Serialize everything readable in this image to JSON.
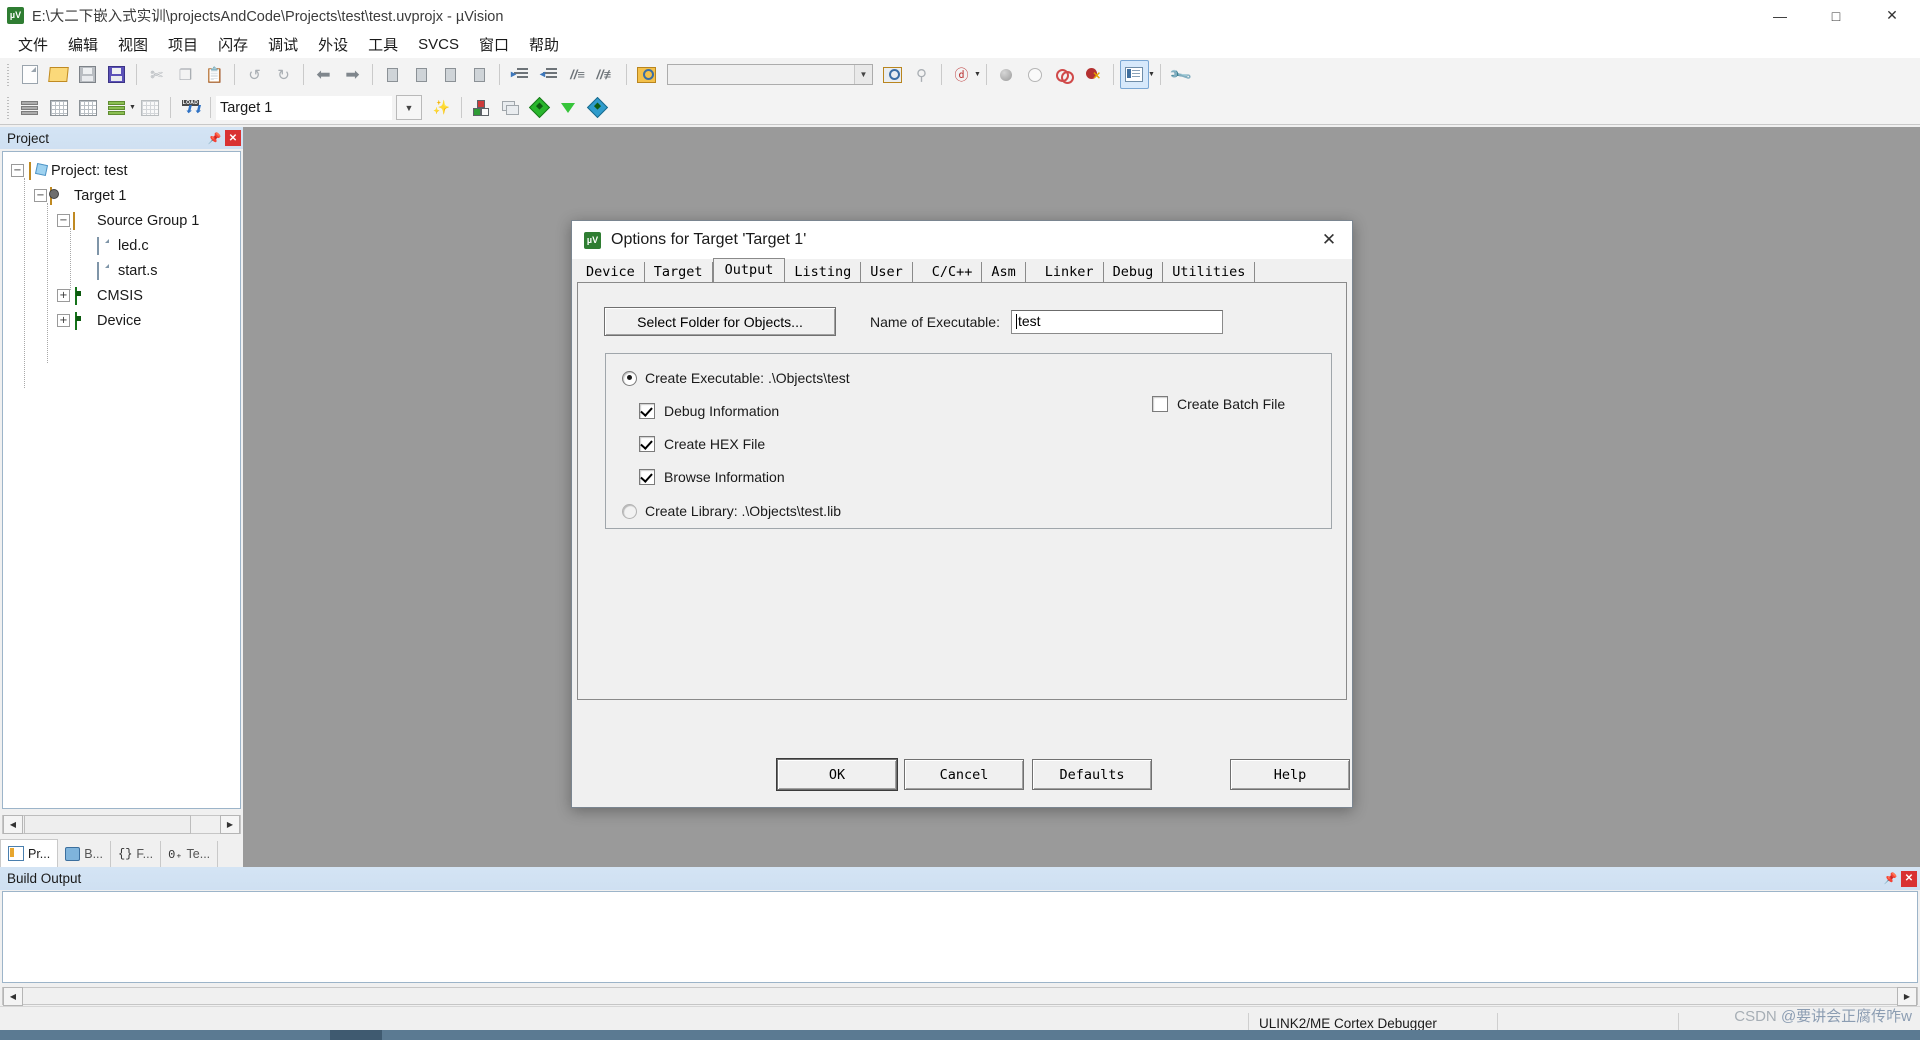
{
  "window": {
    "title": "E:\\大二下嵌入式实训\\projectsAndCode\\Projects\\test\\test.uvprojx - µVision",
    "app_icon_label": "µV",
    "minimize": "—",
    "maximize": "□",
    "close": "✕"
  },
  "menu": {
    "items": [
      {
        "label": "文件"
      },
      {
        "label": "编辑"
      },
      {
        "label": "视图"
      },
      {
        "label": "项目"
      },
      {
        "label": "闪存"
      },
      {
        "label": "调试"
      },
      {
        "label": "外设"
      },
      {
        "label": "工具"
      },
      {
        "label": "SVCS"
      },
      {
        "label": "窗口"
      },
      {
        "label": "帮助"
      }
    ]
  },
  "toolbar_main": {
    "search_placeholder": "",
    "search_value": "",
    "icons": [
      "new-file-icon",
      "open-file-icon",
      "save-icon",
      "save-all-icon",
      "cut-icon",
      "copy-icon",
      "paste-icon",
      "undo-icon",
      "redo-icon",
      "navigate-back-icon",
      "navigate-forward-icon",
      "bookmark-toggle-icon",
      "bookmark-prev-icon",
      "bookmark-next-icon",
      "bookmark-clear-icon",
      "indent-icon",
      "outdent-icon",
      "comment-icon",
      "uncomment-icon",
      "find-in-files-icon",
      "insert-bookmark-icon",
      "find-icon",
      "debug-session-icon",
      "breakpoint-icon",
      "disable-breakpoint-icon",
      "disable-all-breakpoints-icon",
      "kill-all-breakpoints-icon",
      "project-window-icon",
      "configure-icon"
    ]
  },
  "toolbar_build": {
    "target_value": "Target 1",
    "icons": [
      "translate-icon",
      "build-icon",
      "rebuild-icon",
      "batch-build-icon",
      "stop-build-icon",
      "download-icon",
      "target-options-icon",
      "manage-project-items-icon",
      "pack-installer-icon",
      "run-configuration-wizard-icon",
      "manage-run-time-env-icon"
    ]
  },
  "project_panel": {
    "title": "Project",
    "pin_icon": "pin-icon",
    "close_icon": "close-icon",
    "tree": [
      {
        "label": "Project: test",
        "icon": "project-icon",
        "toggle": "−",
        "depth": 0
      },
      {
        "label": "Target 1",
        "icon": "target-icon",
        "toggle": "−",
        "depth": 1
      },
      {
        "label": "Source Group 1",
        "icon": "folder-icon",
        "toggle": "−",
        "depth": 2
      },
      {
        "label": "led.c",
        "icon": "c-file-icon",
        "toggle": "",
        "depth": 3
      },
      {
        "label": "start.s",
        "icon": "asm-file-icon",
        "toggle": "",
        "depth": 3
      },
      {
        "label": "CMSIS",
        "icon": "component-icon",
        "toggle": "+",
        "depth": 2
      },
      {
        "label": "Device",
        "icon": "component-icon",
        "toggle": "+",
        "depth": 2
      }
    ],
    "tabs": [
      {
        "label": "Pr...",
        "icon": "project-tab-icon",
        "active": true
      },
      {
        "label": "B...",
        "icon": "books-tab-icon",
        "active": false
      },
      {
        "label": "F...",
        "icon": "functions-tab-icon",
        "active": false
      },
      {
        "label": "Te...",
        "icon": "templates-tab-icon",
        "active": false
      }
    ],
    "scroll_left": "◀",
    "scroll_right": "▶"
  },
  "build_output": {
    "title": "Build Output",
    "pin_icon": "pin-icon",
    "close_icon": "close-icon",
    "content": "",
    "scroll_left": "◀",
    "scroll_right": "▶"
  },
  "status_bar": {
    "debugger": "ULINK2/ME Cortex Debugger"
  },
  "watermark": {
    "prefix": "CSDN ",
    "text": "@要讲会正腐传咋w"
  },
  "dialog": {
    "title": "Options for Target 'Target 1'",
    "icon_label": "µV",
    "close_label": "✕",
    "tabs": [
      {
        "label": "Device",
        "active": false
      },
      {
        "label": "Target",
        "active": false
      },
      {
        "label": "Output",
        "active": true
      },
      {
        "label": "Listing",
        "active": false
      },
      {
        "label": "User",
        "active": false
      },
      {
        "label": "C/C++",
        "active": false
      },
      {
        "label": "Asm",
        "active": false
      },
      {
        "label": "Linker",
        "active": false
      },
      {
        "label": "Debug",
        "active": false
      },
      {
        "label": "Utilities",
        "active": false
      }
    ],
    "select_folder_button": "Select Folder for Objects...",
    "name_of_executable_label": "Name of Executable:",
    "name_of_executable_value": "test",
    "create_executable": {
      "label": "Create Executable:  .\\Objects\\test",
      "checked": true
    },
    "debug_information": {
      "label": "Debug Information",
      "checked": true
    },
    "create_hex_file": {
      "label": "Create HEX File",
      "checked": true
    },
    "browse_information": {
      "label": "Browse Information",
      "checked": true
    },
    "create_batch_file": {
      "label": "Create Batch File",
      "checked": false
    },
    "create_library": {
      "label": "Create Library:  .\\Objects\\test.lib",
      "checked": false
    },
    "buttons": {
      "ok": "OK",
      "cancel": "Cancel",
      "defaults": "Defaults",
      "help": "Help"
    }
  }
}
